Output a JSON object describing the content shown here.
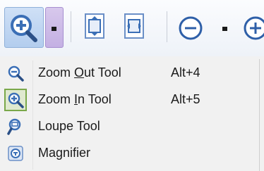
{
  "menu": {
    "items": [
      {
        "label_before": "Zoom ",
        "label_mnemonic": "O",
        "label_after": "ut Tool",
        "shortcut": "Alt+4",
        "icon": "zoom-out-magnifier-icon"
      },
      {
        "label_before": "Zoom ",
        "label_mnemonic": "I",
        "label_after": "n Tool",
        "shortcut": "Alt+5",
        "icon": "zoom-in-magnifier-icon",
        "checked": true
      },
      {
        "label_before": "Loupe Tool",
        "label_mnemonic": "",
        "label_after": "",
        "shortcut": "",
        "icon": "loupe-icon"
      },
      {
        "label_before": "Magnifier",
        "label_mnemonic": "",
        "label_after": "",
        "shortcut": "",
        "icon": "magnifier-icon"
      }
    ]
  },
  "colors": {
    "menu_background": "#f1f1f1",
    "toolbar_button_active": "#b3cdee",
    "dropdown_button_hover": "#c4b0e3",
    "checked_frame": "#7aa84a"
  }
}
